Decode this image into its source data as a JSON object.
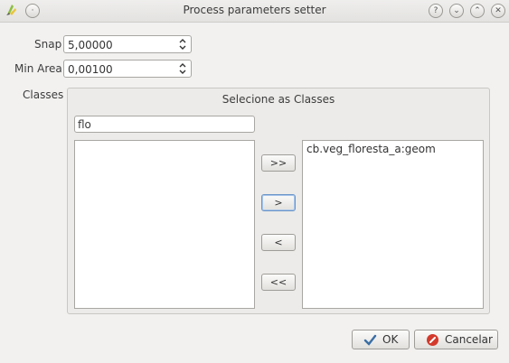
{
  "window": {
    "title": "Process parameters setter",
    "controls": {
      "help": "?",
      "minimize": "⌄",
      "maximize": "⌃",
      "close": "✕"
    }
  },
  "form": {
    "snap": {
      "label": "Snap",
      "value": "5,00000"
    },
    "min_area": {
      "label": "Min Area",
      "value": "0,00100"
    },
    "classes_label": "Classes"
  },
  "classes_group": {
    "title": "Selecione as Classes",
    "filter_value": "flo",
    "available": [],
    "selected": [
      "cb.veg_floresta_a:geom"
    ],
    "buttons": {
      "add_all": ">>",
      "add": ">",
      "remove": "<",
      "remove_all": "<<"
    }
  },
  "dialog_buttons": {
    "ok": "OK",
    "cancel": "Cancelar"
  },
  "colors": {
    "window_bg": "#f2f1f0",
    "ok_check": "#3a6ea5",
    "cancel_icon": "#d33a2c"
  }
}
